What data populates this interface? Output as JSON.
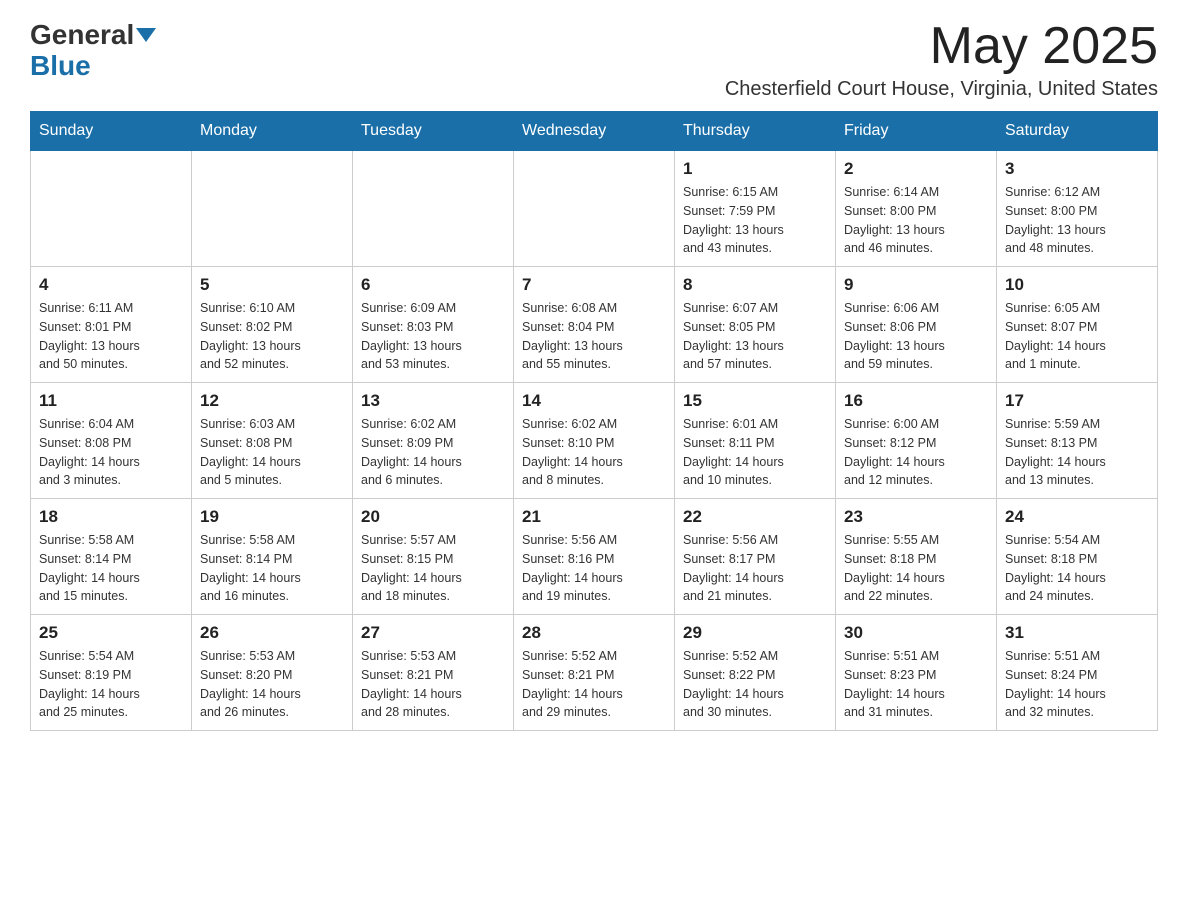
{
  "header": {
    "logo_general": "General",
    "logo_blue": "Blue",
    "month_year": "May 2025",
    "location": "Chesterfield Court House, Virginia, United States"
  },
  "days_of_week": [
    "Sunday",
    "Monday",
    "Tuesday",
    "Wednesday",
    "Thursday",
    "Friday",
    "Saturday"
  ],
  "weeks": [
    [
      {
        "day": "",
        "info": ""
      },
      {
        "day": "",
        "info": ""
      },
      {
        "day": "",
        "info": ""
      },
      {
        "day": "",
        "info": ""
      },
      {
        "day": "1",
        "info": "Sunrise: 6:15 AM\nSunset: 7:59 PM\nDaylight: 13 hours\nand 43 minutes."
      },
      {
        "day": "2",
        "info": "Sunrise: 6:14 AM\nSunset: 8:00 PM\nDaylight: 13 hours\nand 46 minutes."
      },
      {
        "day": "3",
        "info": "Sunrise: 6:12 AM\nSunset: 8:00 PM\nDaylight: 13 hours\nand 48 minutes."
      }
    ],
    [
      {
        "day": "4",
        "info": "Sunrise: 6:11 AM\nSunset: 8:01 PM\nDaylight: 13 hours\nand 50 minutes."
      },
      {
        "day": "5",
        "info": "Sunrise: 6:10 AM\nSunset: 8:02 PM\nDaylight: 13 hours\nand 52 minutes."
      },
      {
        "day": "6",
        "info": "Sunrise: 6:09 AM\nSunset: 8:03 PM\nDaylight: 13 hours\nand 53 minutes."
      },
      {
        "day": "7",
        "info": "Sunrise: 6:08 AM\nSunset: 8:04 PM\nDaylight: 13 hours\nand 55 minutes."
      },
      {
        "day": "8",
        "info": "Sunrise: 6:07 AM\nSunset: 8:05 PM\nDaylight: 13 hours\nand 57 minutes."
      },
      {
        "day": "9",
        "info": "Sunrise: 6:06 AM\nSunset: 8:06 PM\nDaylight: 13 hours\nand 59 minutes."
      },
      {
        "day": "10",
        "info": "Sunrise: 6:05 AM\nSunset: 8:07 PM\nDaylight: 14 hours\nand 1 minute."
      }
    ],
    [
      {
        "day": "11",
        "info": "Sunrise: 6:04 AM\nSunset: 8:08 PM\nDaylight: 14 hours\nand 3 minutes."
      },
      {
        "day": "12",
        "info": "Sunrise: 6:03 AM\nSunset: 8:08 PM\nDaylight: 14 hours\nand 5 minutes."
      },
      {
        "day": "13",
        "info": "Sunrise: 6:02 AM\nSunset: 8:09 PM\nDaylight: 14 hours\nand 6 minutes."
      },
      {
        "day": "14",
        "info": "Sunrise: 6:02 AM\nSunset: 8:10 PM\nDaylight: 14 hours\nand 8 minutes."
      },
      {
        "day": "15",
        "info": "Sunrise: 6:01 AM\nSunset: 8:11 PM\nDaylight: 14 hours\nand 10 minutes."
      },
      {
        "day": "16",
        "info": "Sunrise: 6:00 AM\nSunset: 8:12 PM\nDaylight: 14 hours\nand 12 minutes."
      },
      {
        "day": "17",
        "info": "Sunrise: 5:59 AM\nSunset: 8:13 PM\nDaylight: 14 hours\nand 13 minutes."
      }
    ],
    [
      {
        "day": "18",
        "info": "Sunrise: 5:58 AM\nSunset: 8:14 PM\nDaylight: 14 hours\nand 15 minutes."
      },
      {
        "day": "19",
        "info": "Sunrise: 5:58 AM\nSunset: 8:14 PM\nDaylight: 14 hours\nand 16 minutes."
      },
      {
        "day": "20",
        "info": "Sunrise: 5:57 AM\nSunset: 8:15 PM\nDaylight: 14 hours\nand 18 minutes."
      },
      {
        "day": "21",
        "info": "Sunrise: 5:56 AM\nSunset: 8:16 PM\nDaylight: 14 hours\nand 19 minutes."
      },
      {
        "day": "22",
        "info": "Sunrise: 5:56 AM\nSunset: 8:17 PM\nDaylight: 14 hours\nand 21 minutes."
      },
      {
        "day": "23",
        "info": "Sunrise: 5:55 AM\nSunset: 8:18 PM\nDaylight: 14 hours\nand 22 minutes."
      },
      {
        "day": "24",
        "info": "Sunrise: 5:54 AM\nSunset: 8:18 PM\nDaylight: 14 hours\nand 24 minutes."
      }
    ],
    [
      {
        "day": "25",
        "info": "Sunrise: 5:54 AM\nSunset: 8:19 PM\nDaylight: 14 hours\nand 25 minutes."
      },
      {
        "day": "26",
        "info": "Sunrise: 5:53 AM\nSunset: 8:20 PM\nDaylight: 14 hours\nand 26 minutes."
      },
      {
        "day": "27",
        "info": "Sunrise: 5:53 AM\nSunset: 8:21 PM\nDaylight: 14 hours\nand 28 minutes."
      },
      {
        "day": "28",
        "info": "Sunrise: 5:52 AM\nSunset: 8:21 PM\nDaylight: 14 hours\nand 29 minutes."
      },
      {
        "day": "29",
        "info": "Sunrise: 5:52 AM\nSunset: 8:22 PM\nDaylight: 14 hours\nand 30 minutes."
      },
      {
        "day": "30",
        "info": "Sunrise: 5:51 AM\nSunset: 8:23 PM\nDaylight: 14 hours\nand 31 minutes."
      },
      {
        "day": "31",
        "info": "Sunrise: 5:51 AM\nSunset: 8:24 PM\nDaylight: 14 hours\nand 32 minutes."
      }
    ]
  ]
}
